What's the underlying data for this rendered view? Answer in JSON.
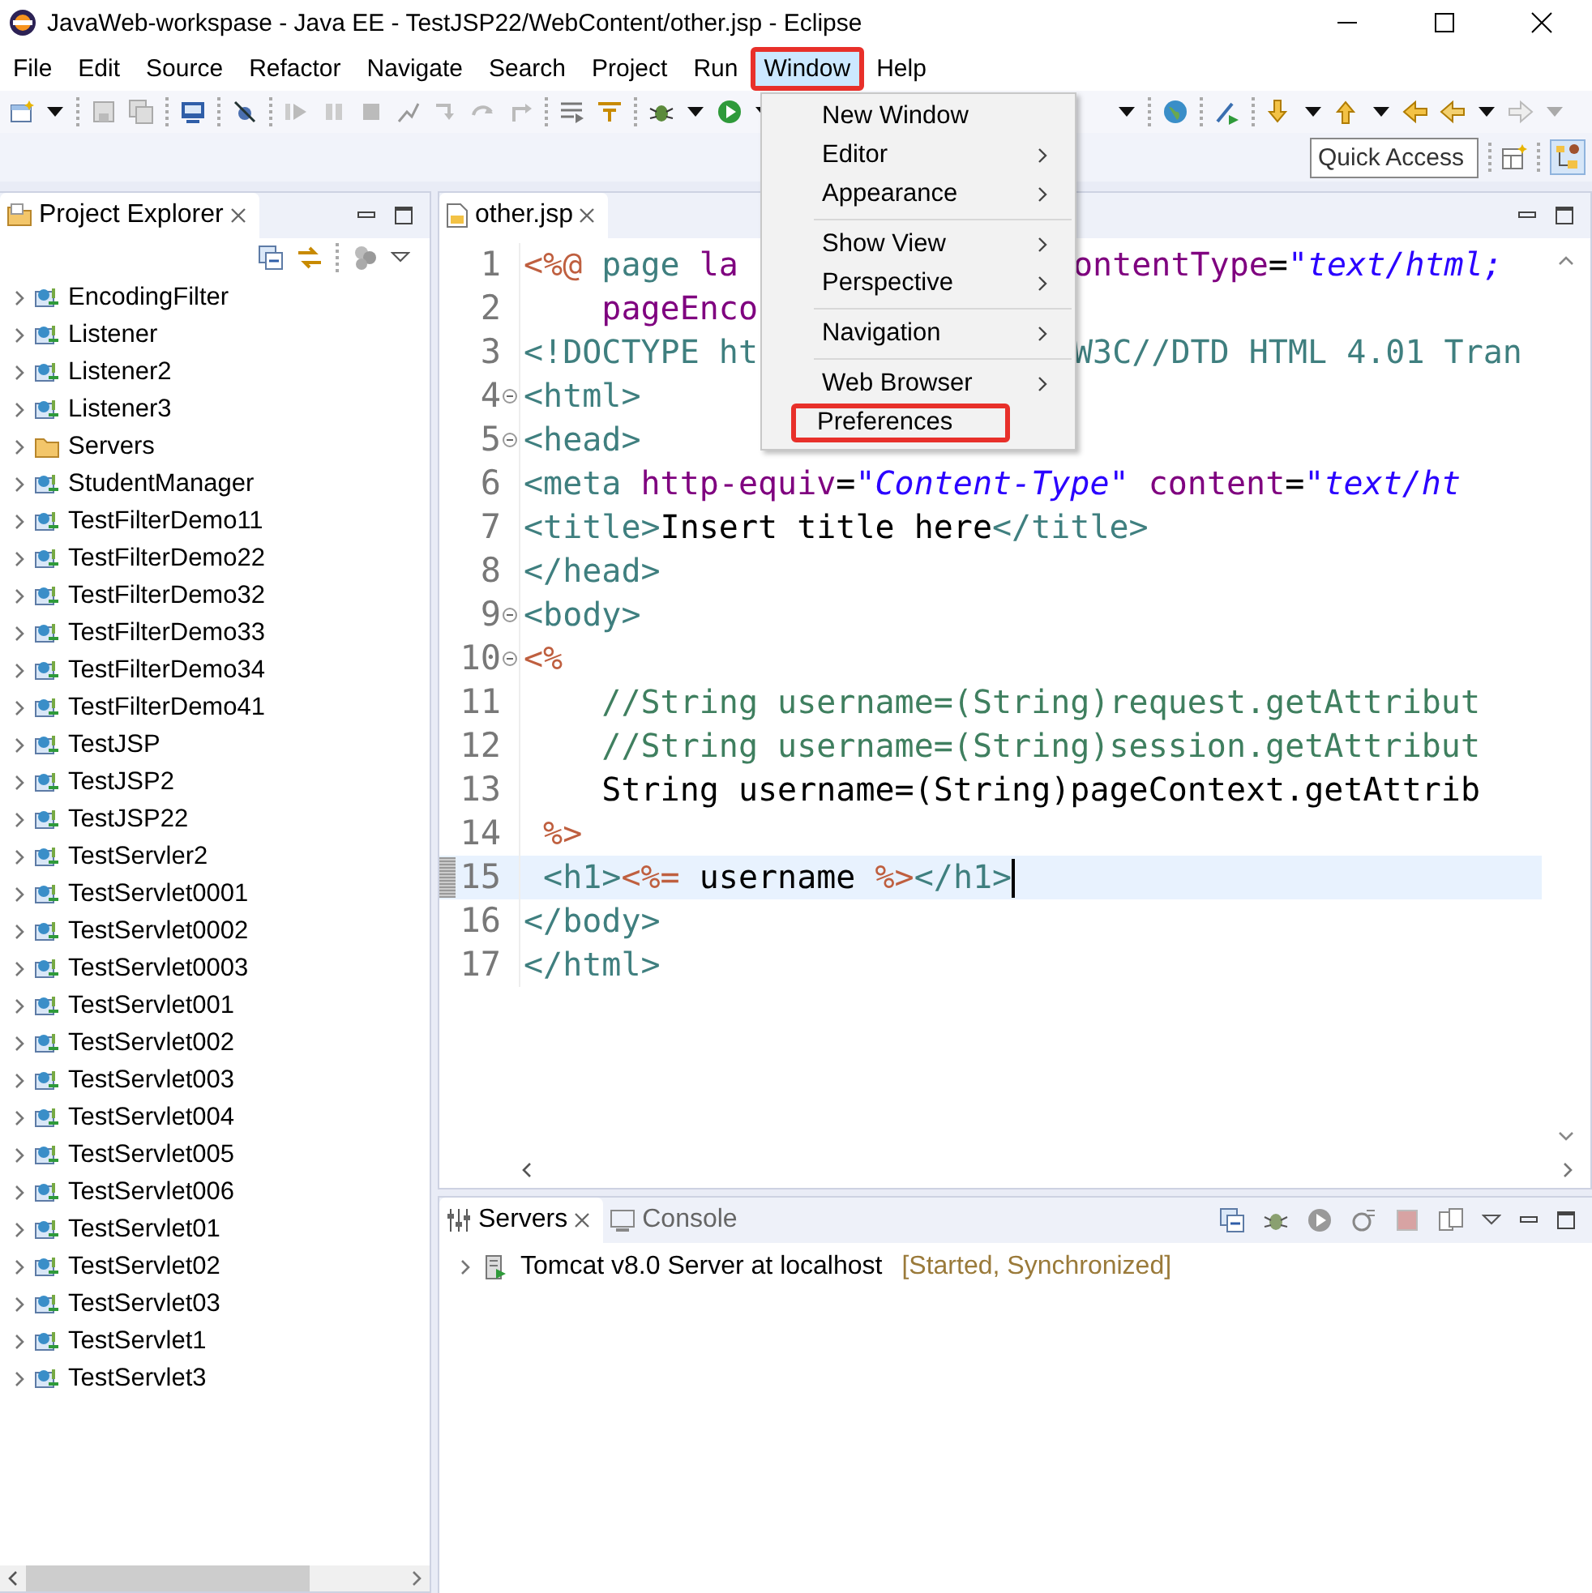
{
  "window": {
    "title": "JavaWeb-workspase - Java EE - TestJSP22/WebContent/other.jsp - Eclipse"
  },
  "menu_bar": [
    {
      "label": "File",
      "selected": false,
      "outlined": false
    },
    {
      "label": "Edit",
      "selected": false,
      "outlined": false
    },
    {
      "label": "Source",
      "selected": false,
      "outlined": false
    },
    {
      "label": "Refactor",
      "selected": false,
      "outlined": false
    },
    {
      "label": "Navigate",
      "selected": false,
      "outlined": false
    },
    {
      "label": "Search",
      "selected": false,
      "outlined": false
    },
    {
      "label": "Project",
      "selected": false,
      "outlined": false
    },
    {
      "label": "Run",
      "selected": false,
      "outlined": false
    },
    {
      "label": "Window",
      "selected": true,
      "outlined": true
    },
    {
      "label": "Help",
      "selected": false,
      "outlined": false
    }
  ],
  "window_menu": {
    "items": [
      {
        "kind": "item",
        "label": "New Window",
        "submenu": false,
        "outlined": false
      },
      {
        "kind": "item",
        "label": "Editor",
        "submenu": true,
        "outlined": false
      },
      {
        "kind": "item",
        "label": "Appearance",
        "submenu": true,
        "outlined": false
      },
      {
        "kind": "separator"
      },
      {
        "kind": "item",
        "label": "Show View",
        "submenu": true,
        "outlined": false
      },
      {
        "kind": "item",
        "label": "Perspective",
        "submenu": true,
        "outlined": false
      },
      {
        "kind": "separator"
      },
      {
        "kind": "item",
        "label": "Navigation",
        "submenu": true,
        "outlined": false
      },
      {
        "kind": "separator"
      },
      {
        "kind": "item",
        "label": "Web Browser",
        "submenu": true,
        "outlined": false
      },
      {
        "kind": "item",
        "label": "Preferences",
        "submenu": false,
        "outlined": true
      }
    ]
  },
  "quick_access": {
    "placeholder": "Quick Access"
  },
  "project_explorer": {
    "tabs": [
      {
        "label": "Project Explorer",
        "selected": true
      }
    ],
    "items": [
      {
        "label": "EncodingFilter",
        "kind": "project"
      },
      {
        "label": "Listener",
        "kind": "project"
      },
      {
        "label": "Listener2",
        "kind": "project"
      },
      {
        "label": "Listener3",
        "kind": "project"
      },
      {
        "label": "Servers",
        "kind": "folder"
      },
      {
        "label": "StudentManager",
        "kind": "project"
      },
      {
        "label": "TestFilterDemo11",
        "kind": "project"
      },
      {
        "label": "TestFilterDemo22",
        "kind": "project"
      },
      {
        "label": "TestFilterDemo32",
        "kind": "project"
      },
      {
        "label": "TestFilterDemo33",
        "kind": "project"
      },
      {
        "label": "TestFilterDemo34",
        "kind": "project"
      },
      {
        "label": "TestFilterDemo41",
        "kind": "project"
      },
      {
        "label": "TestJSP",
        "kind": "project"
      },
      {
        "label": "TestJSP2",
        "kind": "project"
      },
      {
        "label": "TestJSP22",
        "kind": "project"
      },
      {
        "label": "TestServler2",
        "kind": "project"
      },
      {
        "label": "TestServlet0001",
        "kind": "project"
      },
      {
        "label": "TestServlet0002",
        "kind": "project"
      },
      {
        "label": "TestServlet0003",
        "kind": "project"
      },
      {
        "label": "TestServlet001",
        "kind": "project"
      },
      {
        "label": "TestServlet002",
        "kind": "project"
      },
      {
        "label": "TestServlet003",
        "kind": "project"
      },
      {
        "label": "TestServlet004",
        "kind": "project"
      },
      {
        "label": "TestServlet005",
        "kind": "project"
      },
      {
        "label": "TestServlet006",
        "kind": "project"
      },
      {
        "label": "TestServlet01",
        "kind": "project"
      },
      {
        "label": "TestServlet02",
        "kind": "project"
      },
      {
        "label": "TestServlet03",
        "kind": "project"
      },
      {
        "label": "TestServlet1",
        "kind": "project"
      },
      {
        "label": "TestServlet3",
        "kind": "project"
      }
    ]
  },
  "editor": {
    "tabs": [
      {
        "label": "other.jsp",
        "selected": true
      }
    ],
    "lines": [
      {
        "number": "1",
        "fold": false,
        "current": false,
        "left": [
          {
            "kind": "directive",
            "text": "<%@"
          },
          {
            "kind": "element",
            "text": " page"
          },
          {
            "kind": "attr",
            "text": " la"
          }
        ],
        "right": [
          {
            "kind": "attr",
            "text": "ontentType"
          },
          {
            "kind": "plain",
            "text": "="
          },
          {
            "kind": "string",
            "text": "\"text/html;"
          }
        ]
      },
      {
        "number": "2",
        "fold": false,
        "current": false,
        "left": [
          {
            "kind": "attr",
            "text": "    pageEnco"
          }
        ]
      },
      {
        "number": "3",
        "fold": false,
        "current": false,
        "left": [
          {
            "kind": "element",
            "text": "<!DOCTYPE ht"
          }
        ],
        "right": [
          {
            "kind": "element",
            "text": "W3C//DTD HTML 4.01 Tran"
          }
        ]
      },
      {
        "number": "4",
        "fold": true,
        "current": false,
        "left": [
          {
            "kind": "element",
            "text": "<html>"
          }
        ]
      },
      {
        "number": "5",
        "fold": true,
        "current": false,
        "left": [
          {
            "kind": "element",
            "text": "<head>"
          }
        ]
      },
      {
        "number": "6",
        "fold": false,
        "current": false,
        "left": [
          {
            "kind": "element",
            "text": "<meta"
          },
          {
            "kind": "attr",
            "text": " http-equiv"
          },
          {
            "kind": "plain",
            "text": "="
          },
          {
            "kind": "string",
            "text": "\"Content-Type\""
          },
          {
            "kind": "attr",
            "text": " content"
          },
          {
            "kind": "plain",
            "text": "="
          },
          {
            "kind": "string",
            "text": "\"text/ht"
          }
        ]
      },
      {
        "number": "7",
        "fold": false,
        "current": false,
        "left": [
          {
            "kind": "element",
            "text": "<title>"
          },
          {
            "kind": "plain",
            "text": "Insert title here"
          },
          {
            "kind": "element",
            "text": "</title>"
          }
        ]
      },
      {
        "number": "8",
        "fold": false,
        "current": false,
        "left": [
          {
            "kind": "element",
            "text": "</head>"
          }
        ]
      },
      {
        "number": "9",
        "fold": true,
        "current": false,
        "left": [
          {
            "kind": "element",
            "text": "<body>"
          }
        ]
      },
      {
        "number": "10",
        "fold": true,
        "current": false,
        "left": [
          {
            "kind": "directive",
            "text": "<%"
          }
        ]
      },
      {
        "number": "11",
        "fold": false,
        "current": false,
        "left": [
          {
            "kind": "comment",
            "text": "    //String username=(String)request.getAttribut"
          }
        ]
      },
      {
        "number": "12",
        "fold": false,
        "current": false,
        "left": [
          {
            "kind": "comment",
            "text": "    //String username=(String)session.getAttribut"
          }
        ]
      },
      {
        "number": "13",
        "fold": false,
        "current": false,
        "left": [
          {
            "kind": "plain",
            "text": "    String username=(String)pageContext.getAttrib"
          }
        ]
      },
      {
        "number": "14",
        "fold": false,
        "current": false,
        "left": [
          {
            "kind": "directive",
            "text": " %>"
          }
        ]
      },
      {
        "number": "15",
        "fold": false,
        "current": true,
        "left": [
          {
            "kind": "element",
            "text": " <h1>"
          },
          {
            "kind": "directive",
            "text": "<%="
          },
          {
            "kind": "plain",
            "text": " username "
          },
          {
            "kind": "directive",
            "text": "%>"
          },
          {
            "kind": "element",
            "text": "</h1>"
          }
        ]
      },
      {
        "number": "16",
        "fold": false,
        "current": false,
        "left": [
          {
            "kind": "element",
            "text": "</body>"
          }
        ]
      },
      {
        "number": "17",
        "fold": false,
        "current": false,
        "left": [
          {
            "kind": "element",
            "text": "</html>"
          }
        ]
      }
    ]
  },
  "servers_panel": {
    "tabs": [
      {
        "label": "Servers",
        "selected": true
      },
      {
        "label": "Console",
        "selected": false
      }
    ],
    "servers": [
      {
        "name": "Tomcat v8.0 Server at localhost",
        "status": "[Started, Synchronized]",
        "expanded": false
      }
    ]
  }
}
